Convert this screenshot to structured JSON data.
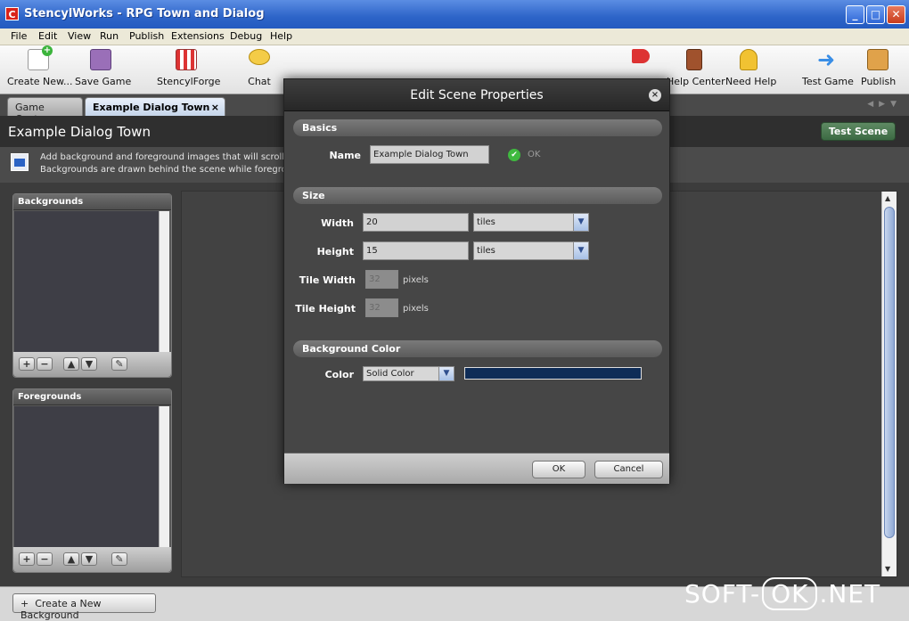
{
  "window": {
    "title": "StencylWorks - RPG Town and Dialog",
    "app_icon": "C"
  },
  "menu": [
    "File",
    "Edit",
    "View",
    "Run",
    "Publish",
    "Extensions",
    "Debug",
    "Help"
  ],
  "toolbar": {
    "create_new": "Create New...",
    "save_game": "Save Game",
    "stencylforge": "StencylForge",
    "chat": "Chat",
    "help_center": "Help Center",
    "need_help": "Need Help",
    "test_game": "Test Game",
    "publish": "Publish"
  },
  "tabs": {
    "game_center": "Game Center",
    "active": "Example Dialog Town",
    "close": "×"
  },
  "header": {
    "title": "Example Dialog Town",
    "test_scene": "Test Scene"
  },
  "info": {
    "line1": "Add background and foreground images that will scroll in",
    "line2": "Backgrounds are drawn behind the scene while foregrour"
  },
  "panels": {
    "backgrounds": "Backgrounds",
    "foregrounds": "Foregrounds"
  },
  "bottom": {
    "create_background": "Create a New Background"
  },
  "watermark": {
    "left": "SOFT-",
    "ok": "OK",
    "right": ".NET"
  },
  "dialog": {
    "title": "Edit Scene Properties",
    "close": "×",
    "basics": {
      "heading": "Basics",
      "name_label": "Name",
      "name_value": "Example Dialog Town",
      "status": "OK"
    },
    "size": {
      "heading": "Size",
      "width_label": "Width",
      "width_value": "20",
      "width_unit": "tiles",
      "height_label": "Height",
      "height_value": "15",
      "height_unit": "tiles",
      "tile_width_label": "Tile Width",
      "tile_width_value": "32",
      "tile_height_label": "Tile Height",
      "tile_height_value": "32",
      "pixels": "pixels"
    },
    "background_color": {
      "heading": "Background Color",
      "color_label": "Color",
      "color_mode": "Solid Color",
      "color_value": "#0e2c57"
    },
    "ok": "OK",
    "cancel": "Cancel"
  }
}
